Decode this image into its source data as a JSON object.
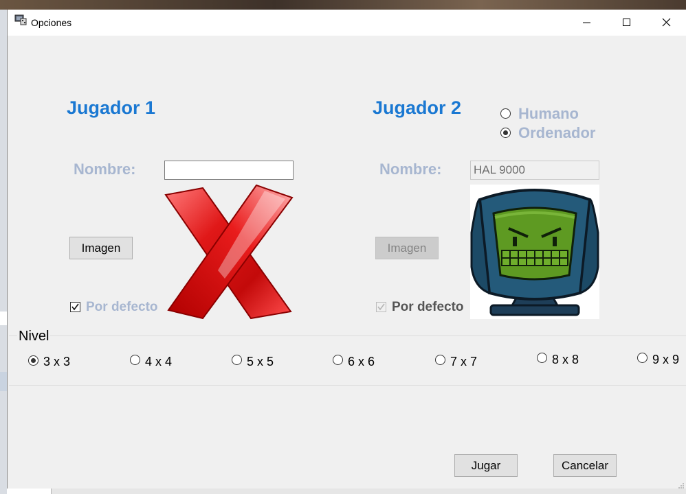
{
  "window": {
    "title": "Opciones"
  },
  "player1": {
    "heading": "Jugador 1",
    "name_label": "Nombre:",
    "name_value": "",
    "image_button": "Imagen",
    "default_label": "Por defecto",
    "default_checked": true
  },
  "player2": {
    "heading": "Jugador 2",
    "type_options": [
      "Humano",
      "Ordenador"
    ],
    "type_selected": "Ordenador",
    "name_label": "Nombre:",
    "name_value": "HAL 9000",
    "image_button": "Imagen",
    "default_label": "Por defecto",
    "default_checked": true
  },
  "level": {
    "title": "Nivel",
    "options": [
      "3 x 3",
      "4 x 4",
      "5 x 5",
      "6 x 6",
      "7 x 7",
      "8 x 8",
      "9 x 9"
    ],
    "selected": "3 x 3"
  },
  "buttons": {
    "play": "Jugar",
    "cancel": "Cancelar"
  },
  "icons": {
    "player1_image": "red-x-icon",
    "player2_image": "robot-monitor-icon"
  },
  "colors": {
    "heading": "#1a78d2",
    "faded_label": "#a7b6d0"
  }
}
